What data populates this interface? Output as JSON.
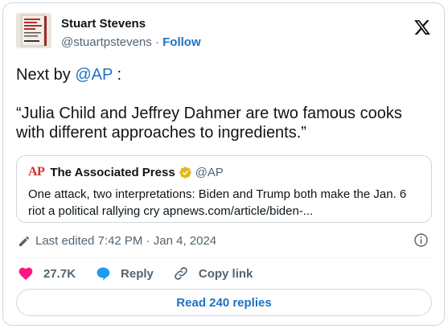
{
  "author": {
    "name": "Stuart Stevens",
    "handle": "@stuartpstevens",
    "separator": " · ",
    "follow_label": "Follow"
  },
  "tweet": {
    "line1_prefix": "Next by ",
    "line1_mention": "@AP",
    "line1_suffix": " :",
    "quote_text": "“Julia Child and Jeffrey Dahmer are two famous cooks with different approaches to ingredients.”"
  },
  "quoted": {
    "logo_text": "AP",
    "name": "The Associated Press",
    "handle": "@AP",
    "text": "One attack, two interpretations: Biden and Trump both make the Jan. 6 riot a political rallying cry apnews.com/article/biden-..."
  },
  "edited_text": "Last edited 7:42 PM · Jan 4, 2024",
  "actions": {
    "like_count": "27.7K",
    "reply_label": "Reply",
    "copy_label": "Copy link"
  },
  "read_replies_label": "Read 240 replies",
  "colors": {
    "accent": "#1d72c4",
    "heart": "#f91880",
    "reply_bubble": "#1d9bf0",
    "verified_gold": "#e2b719",
    "ap_red": "#d32f2f"
  }
}
